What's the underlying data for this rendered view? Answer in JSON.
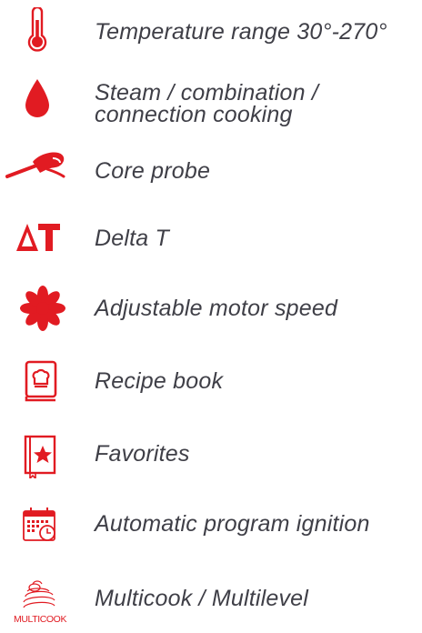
{
  "accent_color": "#e11b22",
  "text_color": "#3f3f47",
  "features": [
    {
      "icon": "thermometer-icon",
      "label": "Temperature range 30°-270°"
    },
    {
      "icon": "water-drop-icon",
      "label": "Steam / combination /\nconnection cooking"
    },
    {
      "icon": "core-probe-icon",
      "label": "Core probe"
    },
    {
      "icon": "delta-t-icon",
      "label": "Delta T"
    },
    {
      "icon": "fan-icon",
      "label": "Adjustable motor speed"
    },
    {
      "icon": "recipe-book-icon",
      "label": "Recipe book"
    },
    {
      "icon": "favorites-icon",
      "label": "Favorites"
    },
    {
      "icon": "calendar-clock-icon",
      "label": "Automatic program ignition"
    },
    {
      "icon": "multicook-logo-icon",
      "label": "Multicook / Multilevel",
      "logo_text": "MULTICOOK"
    }
  ]
}
